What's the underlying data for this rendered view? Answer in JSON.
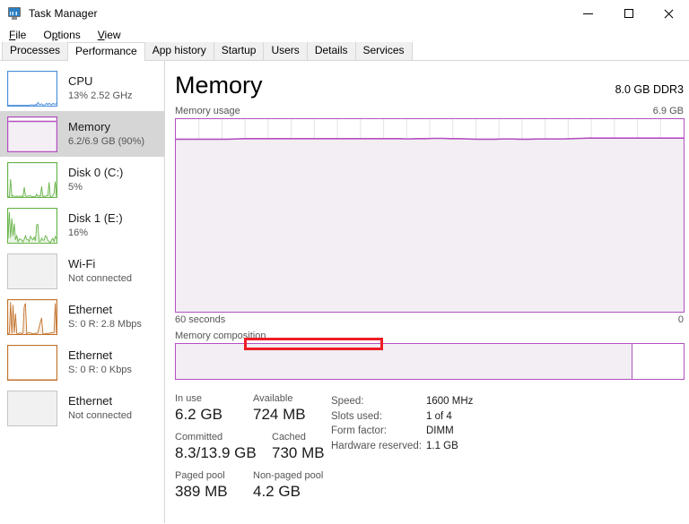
{
  "window": {
    "title": "Task Manager",
    "icon": "task-manager-icon",
    "controls": {
      "minimize": "minimize-icon",
      "maximize": "maximize-icon",
      "close": "close-icon"
    }
  },
  "menubar": {
    "items": [
      "File",
      "Options",
      "View"
    ]
  },
  "tabs": {
    "items": [
      "Processes",
      "Performance",
      "App history",
      "Startup",
      "Users",
      "Details",
      "Services"
    ],
    "active": "Performance"
  },
  "sidebar": {
    "items": [
      {
        "name": "cpu",
        "title": "CPU",
        "sub": "13% 2.52 GHz",
        "color": "#4a90d9",
        "selected": false,
        "connected": true
      },
      {
        "name": "memory",
        "title": "Memory",
        "sub": "6.2/6.9 GB (90%)",
        "color": "#b34fc0",
        "selected": true,
        "connected": true
      },
      {
        "name": "disk-0",
        "title": "Disk 0 (C:)",
        "sub": "5%",
        "color": "#69b44a",
        "selected": false,
        "connected": true
      },
      {
        "name": "disk-1",
        "title": "Disk 1 (E:)",
        "sub": "16%",
        "color": "#69b44a",
        "selected": false,
        "connected": true
      },
      {
        "name": "wifi",
        "title": "Wi-Fi",
        "sub": "Not connected",
        "color": "#c4c4c4",
        "selected": false,
        "connected": false
      },
      {
        "name": "ethernet-1",
        "title": "Ethernet",
        "sub": "S: 0 R: 2.8 Mbps",
        "color": "#c1732c",
        "selected": false,
        "connected": true
      },
      {
        "name": "ethernet-2",
        "title": "Ethernet",
        "sub": "S: 0 R: 0 Kbps",
        "color": "#c1732c",
        "selected": false,
        "connected": true
      },
      {
        "name": "ethernet-3",
        "title": "Ethernet",
        "sub": "Not connected",
        "color": "#c4c4c4",
        "selected": false,
        "connected": false
      }
    ]
  },
  "main": {
    "title": "Memory",
    "spec": "8.0 GB DDR3",
    "accent_color": "#b34fc0",
    "graph": {
      "caption_left": "Memory usage",
      "caption_right": "6.9 GB",
      "axis_left": "60 seconds",
      "axis_right": "0"
    },
    "composition": {
      "label": "Memory composition",
      "in_use_percent": 90,
      "free_percent": 10
    },
    "stats": {
      "in_use_label": "In use",
      "in_use_value": "6.2 GB",
      "available_label": "Available",
      "available_value": "724 MB",
      "committed_label": "Committed",
      "committed_value": "8.3/13.9 GB",
      "cached_label": "Cached",
      "cached_value": "730 MB",
      "paged_pool_label": "Paged pool",
      "paged_pool_value": "389 MB",
      "nonpaged_pool_label": "Non-paged pool",
      "nonpaged_pool_value": "4.2 GB"
    },
    "specs": [
      {
        "key": "Speed:",
        "value": "1600 MHz"
      },
      {
        "key": "Slots used:",
        "value": "1 of 4"
      },
      {
        "key": "Form factor:",
        "value": "DIMM"
      },
      {
        "key": "Hardware reserved:",
        "value": "1.1 GB"
      }
    ]
  },
  "annotation": {
    "highlight_color": "#ee1c25",
    "target": "non-paged-pool-stat"
  },
  "chart_data": {
    "type": "area",
    "title": "Memory usage",
    "xlabel": "60 seconds",
    "ylabel": "6.9 GB",
    "ylim": [
      0,
      6.9
    ],
    "xlim": [
      0,
      60
    ],
    "grid": true,
    "legend": "none",
    "series": [
      {
        "name": "Memory in use (GB)",
        "values": [
          6.18,
          6.18,
          6.18,
          6.18,
          6.18,
          6.18,
          6.18,
          6.19,
          6.2,
          6.2,
          6.2,
          6.2,
          6.2,
          6.2,
          6.2,
          6.2,
          6.2,
          6.2,
          6.2,
          6.2,
          6.2,
          6.2,
          6.2,
          6.2,
          6.2,
          6.2,
          6.2,
          6.19,
          6.2,
          6.2,
          6.21,
          6.21,
          6.2,
          6.2,
          6.19,
          6.18,
          6.18,
          6.18,
          6.19,
          6.19,
          6.18,
          6.18,
          6.19,
          6.19,
          6.19,
          6.19,
          6.2,
          6.21,
          6.22,
          6.22,
          6.22,
          6.22,
          6.22,
          6.22,
          6.22,
          6.22,
          6.22,
          6.22,
          6.22,
          6.22
        ]
      }
    ]
  }
}
